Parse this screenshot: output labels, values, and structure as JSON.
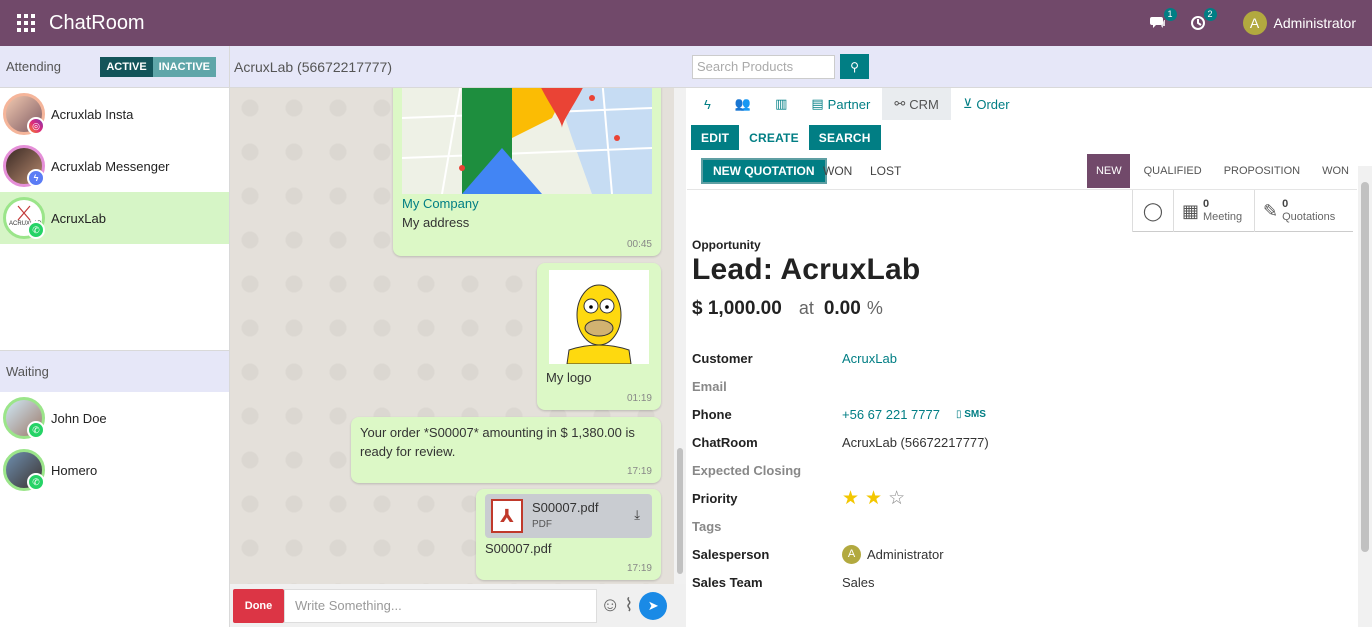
{
  "app": {
    "title": "ChatRoom",
    "user": "Administrator",
    "user_initial": "A",
    "badge_messages": "1",
    "badge_activities": "2"
  },
  "left": {
    "attending_label": "Attending",
    "toggle_active": "ACTIVE",
    "toggle_inactive": "INACTIVE",
    "conversations": [
      {
        "name": "Acruxlab Insta",
        "channel": "instagram"
      },
      {
        "name": "Acruxlab Messenger",
        "channel": "messenger"
      },
      {
        "name": "AcruxLab",
        "channel": "whatsapp",
        "selected": true
      }
    ],
    "waiting_label": "Waiting",
    "waiting": [
      {
        "name": "John Doe",
        "channel": "whatsapp"
      },
      {
        "name": "Homero",
        "channel": "whatsapp"
      }
    ]
  },
  "chat": {
    "header": "AcruxLab (56672217777)",
    "messages": [
      {
        "type": "location",
        "title": "My Company",
        "text": "My address",
        "time": "00:45"
      },
      {
        "type": "image",
        "caption": "My logo",
        "time": "01:19"
      },
      {
        "type": "text",
        "text": "Your order *S00007* amounting in $ 1,380.00 is ready for review.",
        "time": "17:19"
      },
      {
        "type": "file",
        "file_name": "S00007.pdf",
        "file_type": "PDF",
        "caption": "S00007.pdf",
        "time": "17:19"
      }
    ],
    "done_label": "Done",
    "input_placeholder": "Write Something..."
  },
  "right": {
    "search_placeholder": "Search Products",
    "tabs": {
      "partner": "Partner",
      "crm": "CRM",
      "order": "Order"
    },
    "actions": {
      "edit": "EDIT",
      "create": "CREATE",
      "search": "SEARCH"
    },
    "status_buttons": {
      "new_quotation": "NEW QUOTATION",
      "won": "WON",
      "lost": "LOST"
    },
    "stages": [
      "NEW",
      "QUALIFIED",
      "PROPOSITION",
      "WON"
    ],
    "smart": {
      "meeting_count": "0",
      "meeting_label": "Meeting",
      "quotation_count": "0",
      "quotation_label": "Quotations"
    },
    "form": {
      "type_label": "Opportunity",
      "title": "Lead: AcruxLab",
      "revenue": "$ 1,000.00",
      "at": "at",
      "probability": "0.00",
      "pct": "%",
      "fields": {
        "customer_label": "Customer",
        "customer": "AcruxLab",
        "email_label": "Email",
        "phone_label": "Phone",
        "phone": "+56 67 221 7777",
        "sms": "SMS",
        "chatroom_label": "ChatRoom",
        "chatroom": "AcruxLab (56672217777)",
        "closing_label": "Expected Closing",
        "priority_label": "Priority",
        "priority_stars": 2,
        "tags_label": "Tags",
        "salesperson_label": "Salesperson",
        "salesperson": "Administrator",
        "salesperson_initial": "A",
        "team_label": "Sales Team",
        "team": "Sales"
      }
    }
  },
  "colors": {
    "brand": "#71496a",
    "accent": "#017e84",
    "bubble": "#dcf8c6",
    "selected": "#d6f5c6",
    "done": "#dc3545"
  }
}
